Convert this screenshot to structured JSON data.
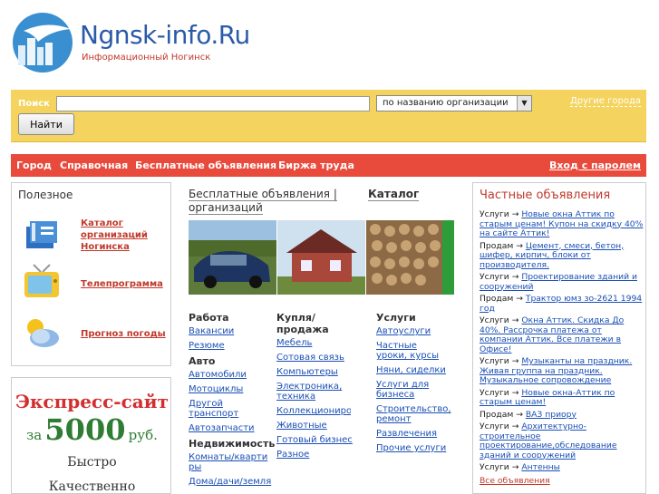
{
  "header": {
    "site_name": "Ngnsk-info.Ru",
    "subtitle": "Информационный Ногинск"
  },
  "search": {
    "label": "Поиск",
    "value": "",
    "mode_selected": "по названию организации",
    "button": "Найти",
    "other_cities": "Другие города"
  },
  "nav": {
    "items": [
      "Город",
      "Справочная",
      "Бесплатные объявления",
      "Биржа труда"
    ],
    "login": "Вход с паролем"
  },
  "useful": {
    "title": "Полезное",
    "items": [
      {
        "label": "Каталог организаций Ногинска",
        "icon": "catalog-book-icon"
      },
      {
        "label": "Телепрограмма",
        "icon": "tv-icon"
      },
      {
        "label": "Прогноз погоды",
        "icon": "weather-icon"
      }
    ]
  },
  "promo": {
    "title": "Экспресс-сайт",
    "price_prefix": "за",
    "price": "5000",
    "currency": "руб.",
    "line1": "Быстро",
    "line2": "Качественно"
  },
  "middle": {
    "heading": "Бесплатные объявления | организаций",
    "catalog": "Каталог",
    "col1": {
      "h1": "Работа",
      "l1": [
        "Вакансии",
        "Резюме"
      ],
      "h2": "Авто",
      "l2": [
        "Автомобили",
        "Мотоциклы",
        "Другой транспорт",
        "Автозапчасти"
      ],
      "h3": "Недвижимость",
      "l3": [
        "Комнаты/квартиры",
        "Дома/дачи/земля"
      ]
    },
    "col2": {
      "h1": "Купля/продажа",
      "l1": [
        "Мебель",
        "Сотовая связь",
        "Компьютеры",
        "Электроника, техника",
        "Коллекционирование",
        "Животные",
        "Готовый бизнес",
        "Разное"
      ]
    },
    "col3": {
      "h1": "Услуги",
      "l1": [
        "Автоуслуги",
        "Частные уроки, курсы",
        "Няни, сиделки",
        "Услуги для бизнеса",
        "Строительство, ремонт",
        "Развлечения",
        "Прочие услуги"
      ]
    }
  },
  "private_ads": {
    "title": "Частные объявления",
    "items": [
      {
        "cat": "Услуги",
        "text": "Новые окна Аттик по старым ценам! Купон на скидку 40% на сайте Аттик!"
      },
      {
        "cat": "Продам",
        "text": "Цемент, смеси, бетон, шифер, кирпич, блоки от производителя."
      },
      {
        "cat": "Услуги",
        "text": "Проектирование зданий и сооружений"
      },
      {
        "cat": "Продам",
        "text": "Трактор юмз зо-2621 1994 год"
      },
      {
        "cat": "Услуги",
        "text": "Окна Аттик. Скидка До 40%. Рассрочка платежа от компании Аттик. Все платежи в Офисе!"
      },
      {
        "cat": "Услуги",
        "text": "Музыканты на праздник. Живая группа на праздник. Музыкальное сопровождение"
      },
      {
        "cat": "Услуги",
        "text": "Новые окна-Аттик по старым ценам!"
      },
      {
        "cat": "Продам",
        "text": "ВАЗ приору"
      },
      {
        "cat": "Услуги",
        "text": "Архитектурно-строительное проектирование,обследование зданий и сооружений"
      },
      {
        "cat": "Услуги",
        "text": "Антенны"
      }
    ],
    "arrow": "→",
    "all_link": "Все объявления"
  },
  "colors": {
    "nav_red": "#e84a3c",
    "search_yellow": "#f4d35e",
    "link_blue": "#1a4fb5",
    "title_red": "#c0392b"
  }
}
